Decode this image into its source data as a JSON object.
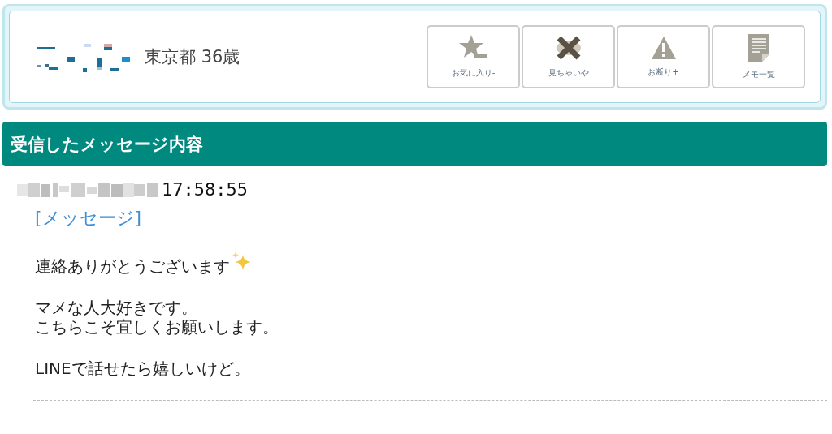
{
  "profile": {
    "location_age": "東京都 36歳"
  },
  "actions": [
    {
      "kind": "star",
      "label": "お気に入り-"
    },
    {
      "kind": "cross",
      "label": "見ちゃいや"
    },
    {
      "kind": "warning",
      "label": "お断り+"
    },
    {
      "kind": "memo",
      "label": "メモ一覧"
    }
  ],
  "section": {
    "title": "受信したメッセージ内容"
  },
  "message": {
    "time": "17:58:55",
    "link": "[メッセージ]",
    "paragraphs": [
      {
        "lines": [
          "連絡ありがとうございます"
        ],
        "sparkle": true
      },
      {
        "lines": [
          "マメな人大好きです。",
          "こちらこそ宜しくお願いします。"
        ],
        "sparkle": false
      },
      {
        "lines": [
          "LINEで話せたら嬉しいけど。"
        ],
        "sparkle": false
      }
    ]
  }
}
